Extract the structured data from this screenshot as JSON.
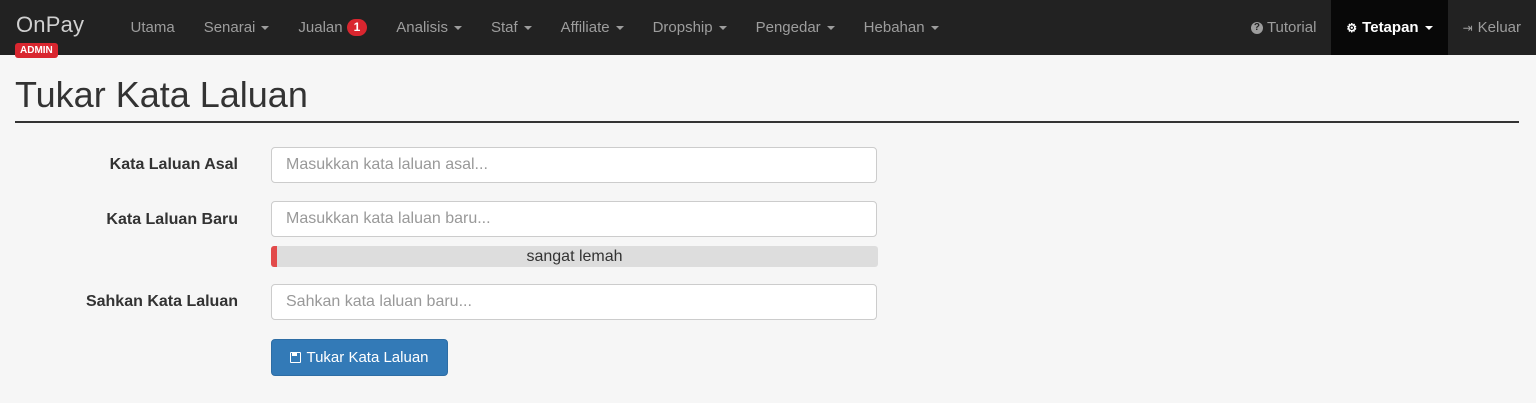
{
  "brand": {
    "name": "OnPay",
    "badge": "ADMIN"
  },
  "nav": {
    "items": [
      {
        "label": "Utama",
        "dropdown": false
      },
      {
        "label": "Senarai",
        "dropdown": true
      },
      {
        "label": "Jualan",
        "dropdown": false,
        "badge": "1"
      },
      {
        "label": "Analisis",
        "dropdown": true
      },
      {
        "label": "Staf",
        "dropdown": true
      },
      {
        "label": "Affiliate",
        "dropdown": true
      },
      {
        "label": "Dropship",
        "dropdown": true
      },
      {
        "label": "Pengedar",
        "dropdown": true
      },
      {
        "label": "Hebahan",
        "dropdown": true
      }
    ],
    "right": {
      "tutorial": "Tutorial",
      "settings": "Tetapan",
      "logout": "Keluar"
    }
  },
  "page": {
    "title": "Tukar Kata Laluan"
  },
  "form": {
    "current": {
      "label": "Kata Laluan Asal",
      "placeholder": "Masukkan kata laluan asal...",
      "value": ""
    },
    "new": {
      "label": "Kata Laluan Baru",
      "placeholder": "Masukkan kata laluan baru...",
      "value": ""
    },
    "strength": {
      "text": "sangat lemah",
      "level": 0.01,
      "color": "#e24a4a"
    },
    "confirm": {
      "label": "Sahkan Kata Laluan",
      "placeholder": "Sahkan kata laluan baru...",
      "value": ""
    },
    "submit": "Tukar Kata Laluan"
  },
  "colors": {
    "navbar": "#222222",
    "accent": "#337ab7",
    "badge": "#d9262f"
  },
  "icons": {
    "tutorial": "question-circle-icon",
    "settings": "cogs-icon",
    "logout": "sign-out-icon",
    "submit": "floppy-disk-icon"
  }
}
